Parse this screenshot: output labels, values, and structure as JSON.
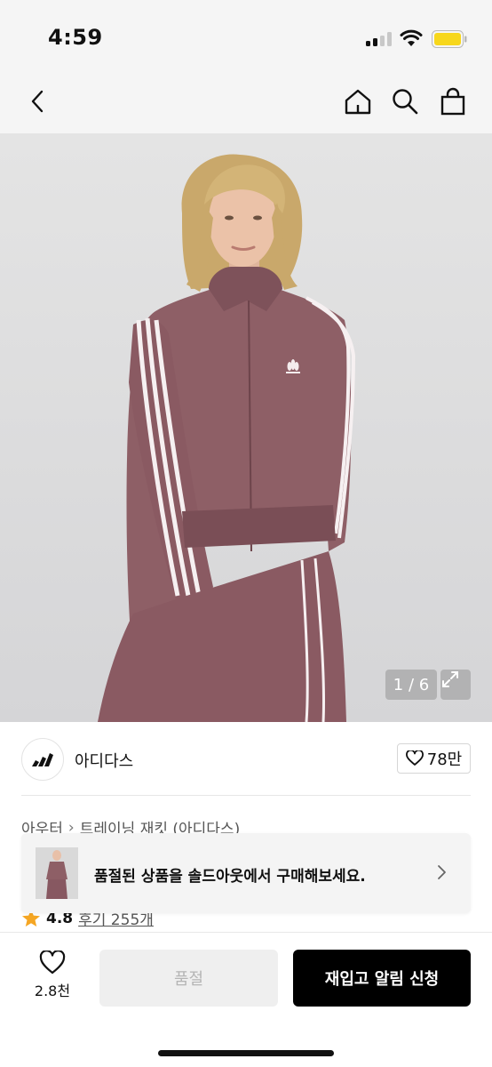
{
  "status_bar": {
    "time": "4:59",
    "battery_color": "#f7d71c"
  },
  "nav": {
    "icons": [
      "back-icon",
      "home-icon",
      "search-icon",
      "shopping-bag-icon"
    ]
  },
  "gallery": {
    "counter": "1 / 6",
    "current_page": 1,
    "total_pages": 6,
    "background_color": "#dcdcde",
    "jacket_color": "#8e5f66"
  },
  "brand": {
    "name": "아디다스",
    "likes": "78만"
  },
  "breadcrumb": {
    "items": [
      "아우터",
      "트레이닝 재킷 (아디다스)"
    ]
  },
  "toast": {
    "message": "품절된 상품을 솔드아웃에서 구매해보세요."
  },
  "rating": {
    "score": "4.8",
    "reviews": "후기 255개",
    "star_color": "#f5a623"
  },
  "bottom_bar": {
    "wish_count": "2.8천",
    "soldout_label": "품절",
    "restock_label": "재입고 알림 신청"
  }
}
